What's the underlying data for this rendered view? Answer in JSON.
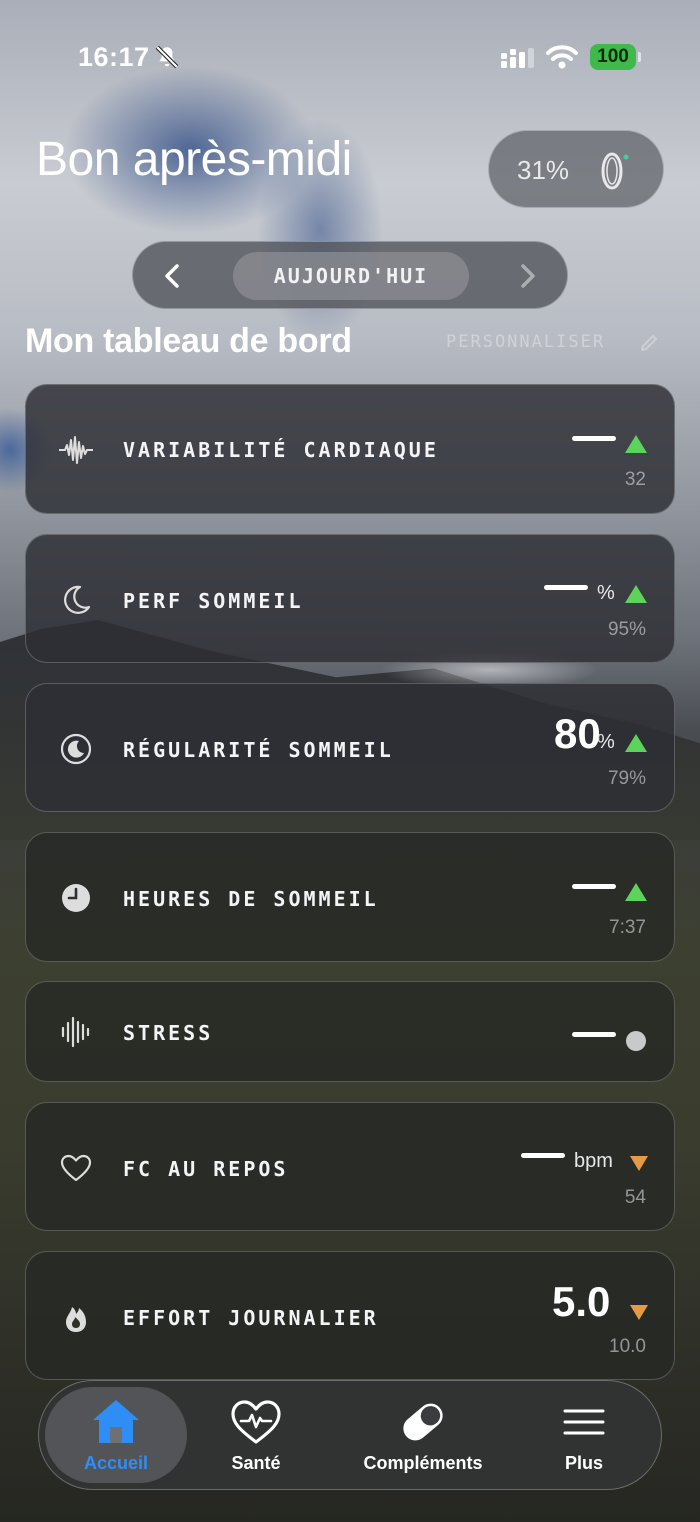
{
  "status_bar": {
    "time": "16:17",
    "battery": "100"
  },
  "header": {
    "greeting": "Bon après-midi",
    "ring_battery": "31%"
  },
  "date_selector": {
    "label": "AUJOURD'HUI"
  },
  "dashboard": {
    "title": "Mon tableau de bord",
    "customize_label": "PERSONNALISER"
  },
  "metrics": [
    {
      "label": "VARIABILITÉ CARDIAQUE",
      "value": "—",
      "unit": "",
      "trend": "up",
      "previous": "32",
      "icon": "waveform-icon"
    },
    {
      "label": "PERF SOMMEIL",
      "value": "—",
      "unit": "%",
      "trend": "up",
      "previous": "95%",
      "icon": "moon-icon"
    },
    {
      "label": "RÉGULARITÉ SOMMEIL",
      "value": "80",
      "unit": "%",
      "trend": "up",
      "previous": "79%",
      "icon": "moon-circle-icon"
    },
    {
      "label": "HEURES DE SOMMEIL",
      "value": "—",
      "unit": "",
      "trend": "up",
      "previous": "7:37",
      "icon": "clock-icon"
    },
    {
      "label": "STRESS",
      "value": "—",
      "unit": "",
      "trend": "neutral",
      "previous": "",
      "icon": "audio-bars-icon"
    },
    {
      "label": "FC AU REPOS",
      "value": "—",
      "unit": "bpm",
      "trend": "down",
      "previous": "54",
      "icon": "heart-icon"
    },
    {
      "label": "EFFORT JOURNALIER",
      "value": "5.0",
      "unit": "",
      "trend": "down",
      "previous": "10.0",
      "icon": "flame-icon"
    }
  ],
  "tab_bar": {
    "tabs": [
      {
        "label": "Accueil",
        "icon": "home-icon",
        "active": true
      },
      {
        "label": "Santé",
        "icon": "heart-pulse-icon",
        "active": false
      },
      {
        "label": "Compléments",
        "icon": "pill-icon",
        "active": false
      },
      {
        "label": "Plus",
        "icon": "menu-icon",
        "active": false
      }
    ]
  },
  "colors": {
    "trend_up": "#5cd35a",
    "trend_down": "#e59a45",
    "accent": "#2f8ef5",
    "battery": "#3fb94a"
  }
}
